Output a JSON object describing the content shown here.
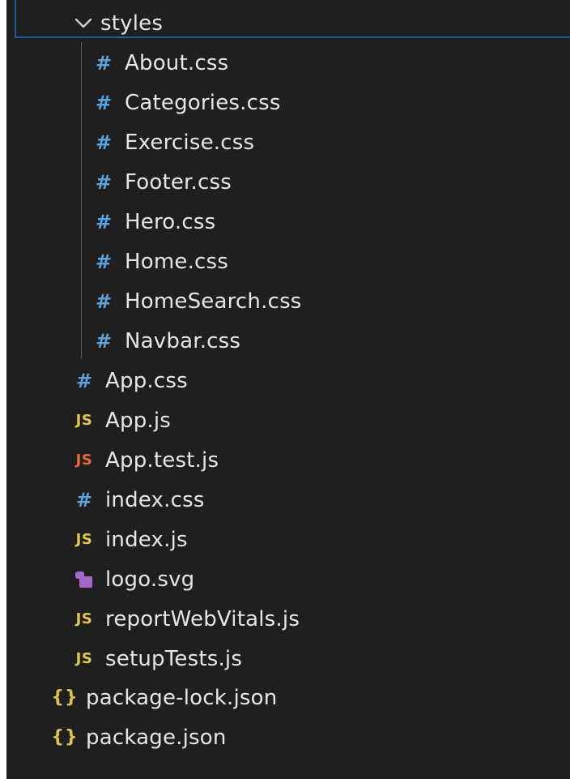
{
  "folder": {
    "name": "styles",
    "expanded": true,
    "chevron_icon": "chevron-down-icon",
    "chevron_color": "#cccccc"
  },
  "colors": {
    "panel_background": "#1e1f1e",
    "focus_outline": "#1f5d99",
    "text": "#e6e6e6",
    "indent_guide": "#585858",
    "css_icon": "#5ba3dc",
    "js_icon": "#e3c64a",
    "test_js_icon": "#e8693a",
    "json_icon": "#dbc24c",
    "svg_icon": "#a567c9"
  },
  "styles_files": [
    {
      "name": "About.css",
      "icon": "hash-icon",
      "glyph": "#",
      "color": "#5ba3dc"
    },
    {
      "name": "Categories.css",
      "icon": "hash-icon",
      "glyph": "#",
      "color": "#5ba3dc"
    },
    {
      "name": "Exercise.css",
      "icon": "hash-icon",
      "glyph": "#",
      "color": "#5ba3dc"
    },
    {
      "name": "Footer.css",
      "icon": "hash-icon",
      "glyph": "#",
      "color": "#5ba3dc"
    },
    {
      "name": "Hero.css",
      "icon": "hash-icon",
      "glyph": "#",
      "color": "#5ba3dc"
    },
    {
      "name": "Home.css",
      "icon": "hash-icon",
      "glyph": "#",
      "color": "#5ba3dc"
    },
    {
      "name": "HomeSearch.css",
      "icon": "hash-icon",
      "glyph": "#",
      "color": "#5ba3dc"
    },
    {
      "name": "Navbar.css",
      "icon": "hash-icon",
      "glyph": "#",
      "color": "#5ba3dc"
    }
  ],
  "src_files": [
    {
      "name": "App.css",
      "icon": "hash-icon",
      "glyph": "#",
      "color": "#5ba3dc"
    },
    {
      "name": "App.js",
      "icon": "js-icon",
      "glyph": "JS",
      "color": "#e3c64a"
    },
    {
      "name": "App.test.js",
      "icon": "js-test-icon",
      "glyph": "JS",
      "color": "#e8693a"
    },
    {
      "name": "index.css",
      "icon": "hash-icon",
      "glyph": "#",
      "color": "#5ba3dc"
    },
    {
      "name": "index.js",
      "icon": "js-icon",
      "glyph": "JS",
      "color": "#e3c64a"
    },
    {
      "name": "logo.svg",
      "icon": "svg-image-icon",
      "glyph": "",
      "color": "#a567c9"
    },
    {
      "name": "reportWebVitals.js",
      "icon": "js-icon",
      "glyph": "JS",
      "color": "#e3c64a"
    },
    {
      "name": "setupTests.js",
      "icon": "js-icon",
      "glyph": "JS",
      "color": "#e3c64a"
    }
  ],
  "root_files": [
    {
      "name": "package-lock.json",
      "icon": "json-braces-icon",
      "glyph": "{}",
      "color": "#dbc24c"
    },
    {
      "name": "package.json",
      "icon": "json-braces-icon",
      "glyph": "{}",
      "color": "#dbc24c"
    }
  ]
}
